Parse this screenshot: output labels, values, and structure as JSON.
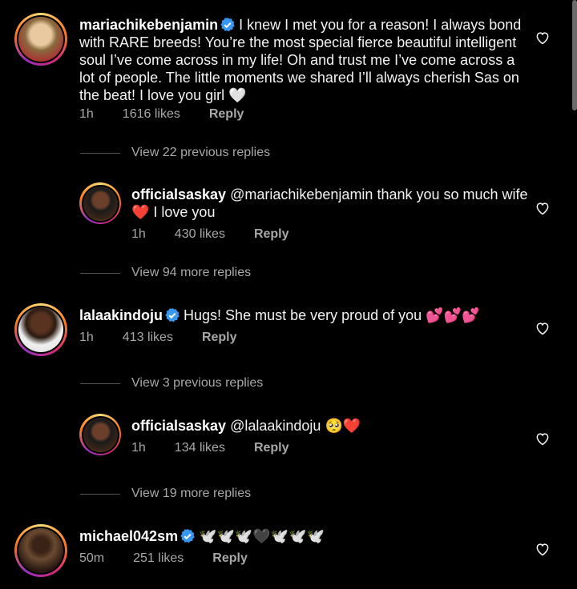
{
  "comments": [
    {
      "username": "mariachikebenjamin",
      "verified": true,
      "text": "I knew I met you for a reason! I always bond with RARE breeds! You’re the most special fierce beautiful intelligent soul I’ve come across in my life! Oh and trust me I’ve come across a lot of people. The little moments we shared I’ll always cherish Sas on the beat! I love you girl 🤍",
      "time": "1h",
      "likes": "1616 likes",
      "reply": "Reply"
    },
    {
      "username": "officialsaskay",
      "verified": false,
      "text": "@mariachikebenjamin thank you so much wife ❤️ I love you",
      "time": "1h",
      "likes": "430 likes",
      "reply": "Reply"
    },
    {
      "username": "lalaakindoju",
      "verified": true,
      "text": "Hugs! She must be very proud of you 💕💕💕",
      "time": "1h",
      "likes": "413 likes",
      "reply": "Reply"
    },
    {
      "username": "officialsaskay",
      "verified": false,
      "text": "@lalaakindoju 🥺❤️",
      "time": "1h",
      "likes": "134 likes",
      "reply": "Reply"
    },
    {
      "username": "michael042sm",
      "verified": true,
      "text": "🕊️🕊️🕊️🖤🕊️🕊️🕊️",
      "time": "50m",
      "likes": "251 likes",
      "reply": "Reply"
    }
  ],
  "view_replies": {
    "prev22": "View 22 previous replies",
    "more94": "View 94 more replies",
    "prev3": "View 3 previous replies",
    "more19": "View 19 more replies"
  },
  "icons": {
    "like": "heart-outline-icon",
    "verified": "verified-badge-icon"
  },
  "colors": {
    "background": "#000000",
    "verified_blue": "#3897f0",
    "meta_gray": "#a8a8a8"
  }
}
